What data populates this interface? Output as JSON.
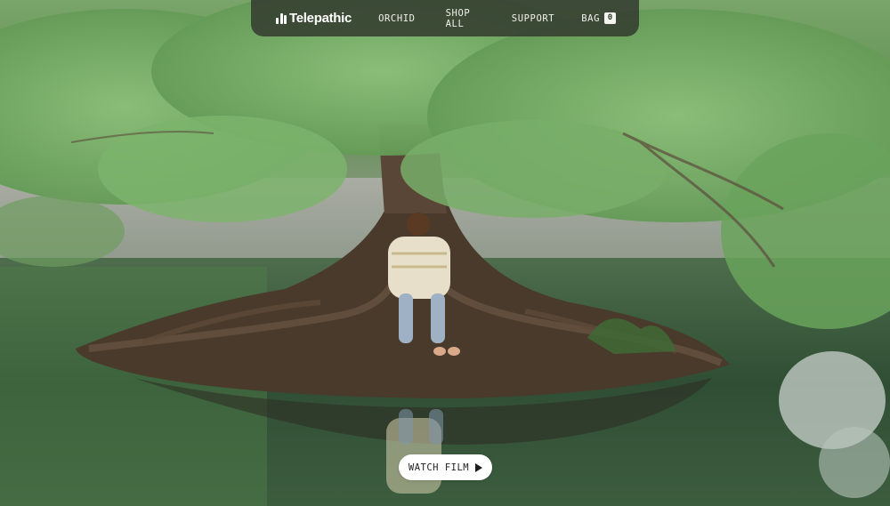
{
  "brand": {
    "name": "Telepathic",
    "logo_icon": "bars-logo-icon"
  },
  "nav": {
    "items": [
      {
        "label": "ORCHID"
      },
      {
        "label": "SHOP ALL"
      },
      {
        "label": "SUPPORT"
      }
    ],
    "bag": {
      "label": "BAG",
      "count": "0"
    }
  },
  "hero": {
    "image_description_alt": "",
    "cta": {
      "label": "WATCH FILM",
      "icon": "play-icon"
    }
  },
  "colors": {
    "nav_bg": "#343e30",
    "cta_bg": "#ffffff",
    "text_light": "#f2f2ee"
  }
}
